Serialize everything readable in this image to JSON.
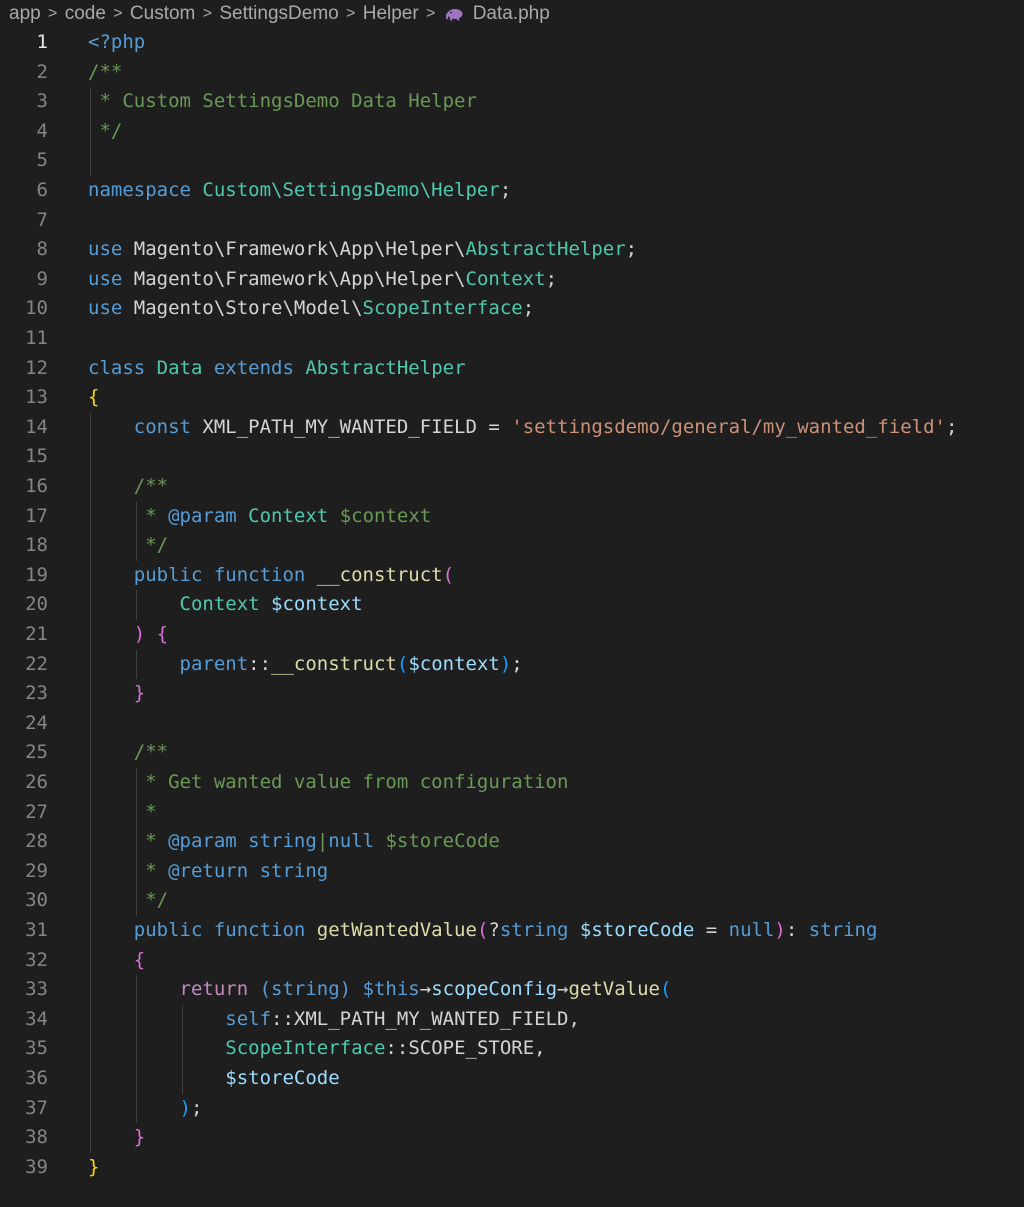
{
  "breadcrumb": {
    "items": [
      "app",
      "code",
      "Custom",
      "SettingsDemo",
      "Helper"
    ],
    "file": "Data.php",
    "file_icon": "php-elephant-icon",
    "separator": ">"
  },
  "editor": {
    "active_line": 1,
    "lines": [
      {
        "n": "1",
        "indent": 0,
        "tokens": [
          {
            "t": "<?php",
            "c": "kw"
          }
        ]
      },
      {
        "n": "2",
        "indent": 0,
        "tokens": [
          {
            "t": "/**",
            "c": "cm"
          }
        ]
      },
      {
        "n": "3",
        "indent": 0,
        "tokens": [
          {
            "t": " * Custom SettingsDemo Data Helper",
            "c": "cm"
          }
        ]
      },
      {
        "n": "4",
        "indent": 0,
        "tokens": [
          {
            "t": " */",
            "c": "cm"
          }
        ]
      },
      {
        "n": "5",
        "indent": 0,
        "tokens": []
      },
      {
        "n": "6",
        "indent": 0,
        "tokens": [
          {
            "t": "namespace ",
            "c": "kw"
          },
          {
            "t": "Custom\\SettingsDemo\\Helper",
            "c": "ty"
          },
          {
            "t": ";",
            "c": "pl"
          }
        ]
      },
      {
        "n": "7",
        "indent": 0,
        "tokens": []
      },
      {
        "n": "8",
        "indent": 0,
        "tokens": [
          {
            "t": "use ",
            "c": "kw"
          },
          {
            "t": "Magento\\Framework\\App\\Helper\\",
            "c": "pl"
          },
          {
            "t": "AbstractHelper",
            "c": "ty"
          },
          {
            "t": ";",
            "c": "pl"
          }
        ]
      },
      {
        "n": "9",
        "indent": 0,
        "tokens": [
          {
            "t": "use ",
            "c": "kw"
          },
          {
            "t": "Magento\\Framework\\App\\Helper\\",
            "c": "pl"
          },
          {
            "t": "Context",
            "c": "ty"
          },
          {
            "t": ";",
            "c": "pl"
          }
        ]
      },
      {
        "n": "10",
        "indent": 0,
        "tokens": [
          {
            "t": "use ",
            "c": "kw"
          },
          {
            "t": "Magento\\Store\\Model\\",
            "c": "pl"
          },
          {
            "t": "ScopeInterface",
            "c": "ty"
          },
          {
            "t": ";",
            "c": "pl"
          }
        ]
      },
      {
        "n": "11",
        "indent": 0,
        "tokens": []
      },
      {
        "n": "12",
        "indent": 0,
        "tokens": [
          {
            "t": "class ",
            "c": "kw"
          },
          {
            "t": "Data ",
            "c": "ty"
          },
          {
            "t": "extends ",
            "c": "kw"
          },
          {
            "t": "AbstractHelper",
            "c": "ty"
          }
        ]
      },
      {
        "n": "13",
        "indent": 0,
        "tokens": [
          {
            "t": "{",
            "c": "br1"
          }
        ]
      },
      {
        "n": "14",
        "indent": 1,
        "tokens": [
          {
            "t": "const ",
            "c": "kw"
          },
          {
            "t": "XML_PATH_MY_WANTED_FIELD",
            "c": "pl"
          },
          {
            "t": " = ",
            "c": "pl"
          },
          {
            "t": "'settingsdemo/general/my_wanted_field'",
            "c": "st"
          },
          {
            "t": ";",
            "c": "pl"
          }
        ]
      },
      {
        "n": "15",
        "indent": 0,
        "tokens": []
      },
      {
        "n": "16",
        "indent": 1,
        "tokens": [
          {
            "t": "/**",
            "c": "cm"
          }
        ]
      },
      {
        "n": "17",
        "indent": 1,
        "tokens": [
          {
            "t": " * ",
            "c": "cm"
          },
          {
            "t": "@param",
            "c": "cmtag"
          },
          {
            "t": " ",
            "c": "cm"
          },
          {
            "t": "Context",
            "c": "cmty"
          },
          {
            "t": " $context",
            "c": "cm"
          }
        ]
      },
      {
        "n": "18",
        "indent": 1,
        "tokens": [
          {
            "t": " */",
            "c": "cm"
          }
        ]
      },
      {
        "n": "19",
        "indent": 1,
        "tokens": [
          {
            "t": "public ",
            "c": "kw"
          },
          {
            "t": "function ",
            "c": "kw"
          },
          {
            "t": "__construct",
            "c": "fn"
          },
          {
            "t": "(",
            "c": "br2"
          }
        ]
      },
      {
        "n": "20",
        "indent": 2,
        "tokens": [
          {
            "t": "Context ",
            "c": "ty"
          },
          {
            "t": "$context",
            "c": "vr"
          }
        ]
      },
      {
        "n": "21",
        "indent": 1,
        "tokens": [
          {
            "t": ")",
            "c": "br2"
          },
          {
            "t": " ",
            "c": "pl"
          },
          {
            "t": "{",
            "c": "br2"
          }
        ]
      },
      {
        "n": "22",
        "indent": 2,
        "tokens": [
          {
            "t": "parent",
            "c": "kw"
          },
          {
            "t": "::",
            "c": "pl"
          },
          {
            "t": "__construct",
            "c": "fn"
          },
          {
            "t": "(",
            "c": "br3"
          },
          {
            "t": "$context",
            "c": "vr"
          },
          {
            "t": ")",
            "c": "br3"
          },
          {
            "t": ";",
            "c": "pl"
          }
        ]
      },
      {
        "n": "23",
        "indent": 1,
        "tokens": [
          {
            "t": "}",
            "c": "br2"
          }
        ]
      },
      {
        "n": "24",
        "indent": 0,
        "tokens": []
      },
      {
        "n": "25",
        "indent": 1,
        "tokens": [
          {
            "t": "/**",
            "c": "cm"
          }
        ]
      },
      {
        "n": "26",
        "indent": 1,
        "tokens": [
          {
            "t": " * Get wanted value from configuration",
            "c": "cm"
          }
        ]
      },
      {
        "n": "27",
        "indent": 1,
        "tokens": [
          {
            "t": " *",
            "c": "cm"
          }
        ]
      },
      {
        "n": "28",
        "indent": 1,
        "tokens": [
          {
            "t": " * ",
            "c": "cm"
          },
          {
            "t": "@param",
            "c": "cmtag"
          },
          {
            "t": " ",
            "c": "cm"
          },
          {
            "t": "string",
            "c": "cmtag"
          },
          {
            "t": "|",
            "c": "cm"
          },
          {
            "t": "null",
            "c": "cmtag"
          },
          {
            "t": " $storeCode",
            "c": "cm"
          }
        ]
      },
      {
        "n": "29",
        "indent": 1,
        "tokens": [
          {
            "t": " * ",
            "c": "cm"
          },
          {
            "t": "@return",
            "c": "cmtag"
          },
          {
            "t": " ",
            "c": "cm"
          },
          {
            "t": "string",
            "c": "cmtag"
          }
        ]
      },
      {
        "n": "30",
        "indent": 1,
        "tokens": [
          {
            "t": " */",
            "c": "cm"
          }
        ]
      },
      {
        "n": "31",
        "indent": 1,
        "tokens": [
          {
            "t": "public ",
            "c": "kw"
          },
          {
            "t": "function ",
            "c": "kw"
          },
          {
            "t": "getWantedValue",
            "c": "fn"
          },
          {
            "t": "(",
            "c": "br2"
          },
          {
            "t": "?",
            "c": "pl"
          },
          {
            "t": "string ",
            "c": "kw"
          },
          {
            "t": "$storeCode",
            "c": "vr"
          },
          {
            "t": " = ",
            "c": "pl"
          },
          {
            "t": "null",
            "c": "kw"
          },
          {
            "t": ")",
            "c": "br2"
          },
          {
            "t": ": ",
            "c": "pl"
          },
          {
            "t": "string",
            "c": "kw"
          }
        ]
      },
      {
        "n": "32",
        "indent": 1,
        "tokens": [
          {
            "t": "{",
            "c": "br2"
          }
        ]
      },
      {
        "n": "33",
        "indent": 2,
        "tokens": [
          {
            "t": "return ",
            "c": "ctl"
          },
          {
            "t": "(string) ",
            "c": "kw"
          },
          {
            "t": "$this",
            "c": "kw"
          },
          {
            "t": "→",
            "c": "pl"
          },
          {
            "t": "scopeConfig",
            "c": "vr"
          },
          {
            "t": "→",
            "c": "pl"
          },
          {
            "t": "getValue",
            "c": "fn"
          },
          {
            "t": "(",
            "c": "br3"
          }
        ]
      },
      {
        "n": "34",
        "indent": 3,
        "tokens": [
          {
            "t": "self",
            "c": "kw"
          },
          {
            "t": "::",
            "c": "pl"
          },
          {
            "t": "XML_PATH_MY_WANTED_FIELD",
            "c": "pl"
          },
          {
            "t": ",",
            "c": "pl"
          }
        ]
      },
      {
        "n": "35",
        "indent": 3,
        "tokens": [
          {
            "t": "ScopeInterface",
            "c": "ty"
          },
          {
            "t": "::",
            "c": "pl"
          },
          {
            "t": "SCOPE_STORE",
            "c": "pl"
          },
          {
            "t": ",",
            "c": "pl"
          }
        ]
      },
      {
        "n": "36",
        "indent": 3,
        "tokens": [
          {
            "t": "$storeCode",
            "c": "vr"
          }
        ]
      },
      {
        "n": "37",
        "indent": 2,
        "tokens": [
          {
            "t": ")",
            "c": "br3"
          },
          {
            "t": ";",
            "c": "pl"
          }
        ]
      },
      {
        "n": "38",
        "indent": 1,
        "tokens": [
          {
            "t": "}",
            "c": "br2"
          }
        ]
      },
      {
        "n": "39",
        "indent": 0,
        "tokens": [
          {
            "t": "}",
            "c": "br1"
          }
        ]
      }
    ]
  },
  "colors": {
    "background": "#1e1e1e",
    "line_number": "#858585",
    "line_number_active": "#e6e6e6",
    "keyword": "#569cd6",
    "type": "#4ec9b0",
    "function": "#dcdcaa",
    "variable": "#9cdcfe",
    "string": "#ce9178",
    "comment": "#6a9955",
    "bracket_level_1": "#ffd700",
    "bracket_level_2": "#da70d6",
    "bracket_level_3": "#179fff"
  }
}
